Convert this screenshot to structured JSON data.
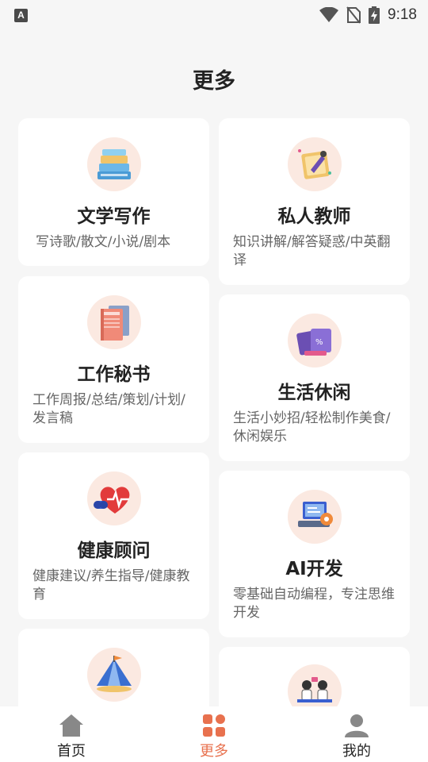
{
  "status": {
    "time": "9:18",
    "notification_icon": "a-icon"
  },
  "page": {
    "title": "更多"
  },
  "cards": [
    {
      "title": "文学写作",
      "desc": "写诗歌/散文/小说/剧本",
      "icon": "books-icon"
    },
    {
      "title": "私人教师",
      "desc": "知识讲解/解答疑惑/中英翻译",
      "icon": "teacher-icon"
    },
    {
      "title": "工作秘书",
      "desc": "工作周报/总结/策划/计划/发言稿",
      "icon": "notebook-icon"
    },
    {
      "title": "生活休闲",
      "desc": "生活小妙招/轻松制作美食/休闲娱乐",
      "icon": "leisure-icon"
    },
    {
      "title": "健康顾问",
      "desc": "健康建议/养生指导/健康教育",
      "icon": "heart-pulse-icon"
    },
    {
      "title": "AI开发",
      "desc": "零基础自动编程，专注思维开发",
      "icon": "code-dev-icon"
    },
    {
      "title": "",
      "desc": "",
      "icon": "tent-icon"
    },
    {
      "title": "",
      "desc": "",
      "icon": "meeting-icon"
    }
  ],
  "tabs": [
    {
      "label": "首页",
      "icon": "home-icon",
      "active": false
    },
    {
      "label": "更多",
      "icon": "grid-icon",
      "active": true
    },
    {
      "label": "我的",
      "icon": "user-icon",
      "active": false
    }
  ],
  "colors": {
    "accent": "#e8714e",
    "icon_bg": "#fbe9e1",
    "background": "#f6f6f6"
  }
}
